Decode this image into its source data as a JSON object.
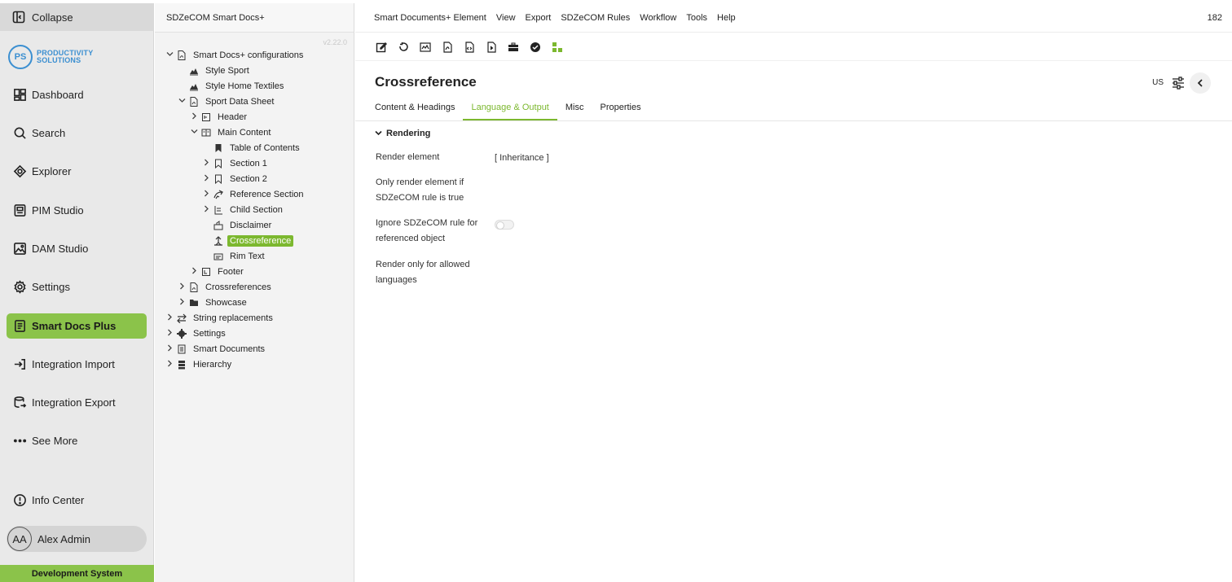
{
  "nav": {
    "collapse_label": "Collapse",
    "logo": {
      "mark": "PS",
      "line1": "PRODUCTIVITY",
      "line2": "SOLUTIONS"
    },
    "items": [
      {
        "label": "Dashboard",
        "icon": "dashboard-icon"
      },
      {
        "label": "Search",
        "icon": "search-icon"
      },
      {
        "label": "Explorer",
        "icon": "explorer-icon"
      },
      {
        "label": "PIM Studio",
        "icon": "pim-studio-icon"
      },
      {
        "label": "DAM Studio",
        "icon": "image-icon"
      },
      {
        "label": "Settings",
        "icon": "gear-icon"
      },
      {
        "label": "Smart Docs Plus",
        "icon": "document-icon",
        "active": true
      },
      {
        "label": "Integration Import",
        "icon": "import-icon"
      },
      {
        "label": "Integration Export",
        "icon": "export-icon"
      },
      {
        "label": "See More",
        "icon": "more-icon"
      }
    ],
    "info_center": "Info Center",
    "user": {
      "initials": "AA",
      "name": "Alex Admin"
    },
    "environment": "Development System",
    "accent_color": "#8bc34a"
  },
  "tree": {
    "title": "SDZeCOM Smart Docs+",
    "version": "v2.22.0",
    "nodes": [
      {
        "label": "Smart Docs+ configurations",
        "icon": "pdf-icon",
        "expanded": true
      },
      {
        "label": "Style Sport",
        "icon": "style-icon"
      },
      {
        "label": "Style Home Textiles",
        "icon": "style-icon"
      },
      {
        "label": "Sport Data Sheet",
        "icon": "pdf-icon",
        "expanded": true
      },
      {
        "label": "Header",
        "icon": "header-icon",
        "collapsed": true
      },
      {
        "label": "Main Content",
        "icon": "content-icon",
        "expanded": true
      },
      {
        "label": "Table of Contents",
        "icon": "bookmark-icon"
      },
      {
        "label": "Section 1",
        "icon": "section-icon",
        "collapsed": true
      },
      {
        "label": "Section 2",
        "icon": "section-icon",
        "collapsed": true
      },
      {
        "label": "Reference Section",
        "icon": "reference-icon",
        "collapsed": true
      },
      {
        "label": "Child Section",
        "icon": "child-section-icon",
        "collapsed": true
      },
      {
        "label": "Disclaimer",
        "icon": "disclaimer-icon"
      },
      {
        "label": "Crossreference",
        "icon": "crossreference-icon",
        "selected": true
      },
      {
        "label": "Rim Text",
        "icon": "rim-text-icon"
      },
      {
        "label": "Footer",
        "icon": "footer-icon",
        "collapsed": true
      },
      {
        "label": "Crossreferences",
        "icon": "pdf-icon",
        "collapsed": true
      },
      {
        "label": "Showcase",
        "icon": "folder-icon",
        "collapsed": true
      },
      {
        "label": "String replacements",
        "icon": "swap-icon",
        "collapsed": true
      },
      {
        "label": "Settings",
        "icon": "gear-icon",
        "collapsed": true
      },
      {
        "label": "Smart Documents",
        "icon": "smart-documents-icon",
        "collapsed": true
      },
      {
        "label": "Hierarchy",
        "icon": "hierarchy-icon",
        "collapsed": true
      }
    ]
  },
  "main": {
    "menu": [
      "Smart Documents+ Element",
      "View",
      "Export",
      "SDZeCOM Rules",
      "Workflow",
      "Tools",
      "Help"
    ],
    "menu_count": "182",
    "toolbar": [
      "edit-icon",
      "reload-icon",
      "preview-icon",
      "pdf-icon",
      "code-icon",
      "export-file-icon",
      "briefcase-icon",
      "check-circle-icon",
      "tree-icon"
    ],
    "title": "Crossreference",
    "locale": "US",
    "tabs": [
      {
        "label": "Content & Headings"
      },
      {
        "label": "Language & Output",
        "active": true
      },
      {
        "label": "Misc"
      },
      {
        "label": "Properties"
      }
    ],
    "section": "Rendering",
    "fields": {
      "render_element": {
        "label": "Render element",
        "value": "[ Inheritance ]"
      },
      "only_render_if": {
        "label": "Only render element if SDZeCOM rule is true"
      },
      "ignore_rule": {
        "label": "Ignore SDZeCOM rule for referenced object",
        "value": false
      },
      "allowed_languages": {
        "label": "Render only for allowed languages"
      }
    },
    "accent_color": "#7cb82f"
  }
}
